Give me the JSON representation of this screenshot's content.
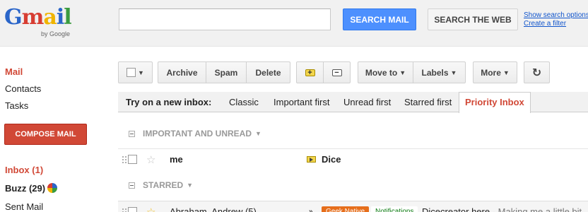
{
  "app": {
    "logo_text": "Gmail",
    "logo_sub": "by Google"
  },
  "search": {
    "value": "",
    "placeholder": "",
    "search_mail_label": "SEARCH MAIL",
    "search_web_label": "SEARCH THE WEB",
    "show_options_label": "Show search options",
    "create_filter_label": "Create a filter"
  },
  "sidebar": {
    "nav": [
      "Mail",
      "Contacts",
      "Tasks"
    ],
    "compose_label": "COMPOSE MAIL",
    "folders": {
      "inbox": "Inbox (1)",
      "buzz": "Buzz (29)",
      "sent": "Sent Mail"
    }
  },
  "toolbar": {
    "archive": "Archive",
    "spam": "Spam",
    "delete": "Delete",
    "move_to": "Move to",
    "labels": "Labels",
    "more": "More",
    "refresh_icon": "refresh-icon"
  },
  "inbox_types": {
    "prompt": "Try on a new inbox:",
    "tabs": [
      "Classic",
      "Important first",
      "Unread first",
      "Starred first",
      "Priority Inbox"
    ],
    "selected": "Priority Inbox"
  },
  "sections": {
    "important": "IMPORTANT AND UNREAD",
    "starred": "STARRED"
  },
  "messages": {
    "important_row": {
      "sender": "me",
      "subject": "Dice"
    },
    "starred_row": {
      "sender": "Abraham, Andrew (5)",
      "chip_1": "Geek Native",
      "chip_2": "Notifications",
      "subject": "Dicecreator here",
      "snippet": " - Making me a little bit"
    }
  },
  "colors": {
    "accent_red": "#d14836",
    "search_blue": "#4d90fe",
    "link_blue": "#1155cc",
    "label_orange": "#e66e1b"
  }
}
